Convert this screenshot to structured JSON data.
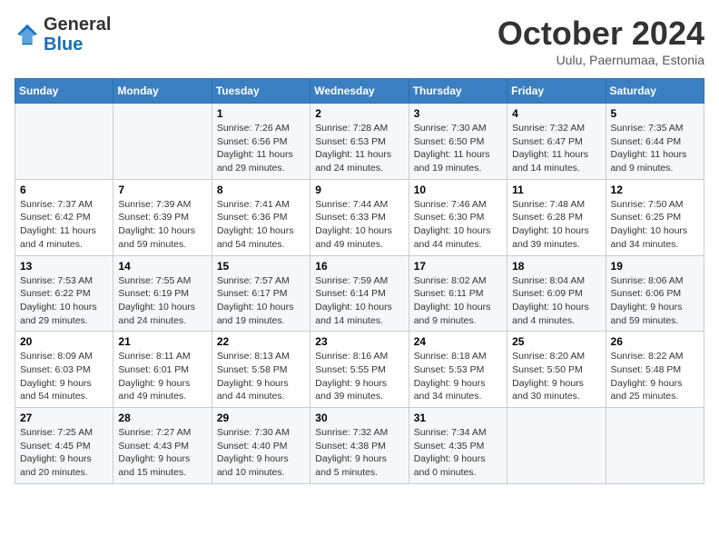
{
  "header": {
    "logo_general": "General",
    "logo_blue": "Blue",
    "month": "October 2024",
    "location": "Uulu, Paernumaa, Estonia"
  },
  "weekdays": [
    "Sunday",
    "Monday",
    "Tuesday",
    "Wednesday",
    "Thursday",
    "Friday",
    "Saturday"
  ],
  "weeks": [
    [
      {
        "day": "",
        "info": ""
      },
      {
        "day": "",
        "info": ""
      },
      {
        "day": "1",
        "info": "Sunrise: 7:26 AM\nSunset: 6:56 PM\nDaylight: 11 hours\nand 29 minutes."
      },
      {
        "day": "2",
        "info": "Sunrise: 7:28 AM\nSunset: 6:53 PM\nDaylight: 11 hours\nand 24 minutes."
      },
      {
        "day": "3",
        "info": "Sunrise: 7:30 AM\nSunset: 6:50 PM\nDaylight: 11 hours\nand 19 minutes."
      },
      {
        "day": "4",
        "info": "Sunrise: 7:32 AM\nSunset: 6:47 PM\nDaylight: 11 hours\nand 14 minutes."
      },
      {
        "day": "5",
        "info": "Sunrise: 7:35 AM\nSunset: 6:44 PM\nDaylight: 11 hours\nand 9 minutes."
      }
    ],
    [
      {
        "day": "6",
        "info": "Sunrise: 7:37 AM\nSunset: 6:42 PM\nDaylight: 11 hours\nand 4 minutes."
      },
      {
        "day": "7",
        "info": "Sunrise: 7:39 AM\nSunset: 6:39 PM\nDaylight: 10 hours\nand 59 minutes."
      },
      {
        "day": "8",
        "info": "Sunrise: 7:41 AM\nSunset: 6:36 PM\nDaylight: 10 hours\nand 54 minutes."
      },
      {
        "day": "9",
        "info": "Sunrise: 7:44 AM\nSunset: 6:33 PM\nDaylight: 10 hours\nand 49 minutes."
      },
      {
        "day": "10",
        "info": "Sunrise: 7:46 AM\nSunset: 6:30 PM\nDaylight: 10 hours\nand 44 minutes."
      },
      {
        "day": "11",
        "info": "Sunrise: 7:48 AM\nSunset: 6:28 PM\nDaylight: 10 hours\nand 39 minutes."
      },
      {
        "day": "12",
        "info": "Sunrise: 7:50 AM\nSunset: 6:25 PM\nDaylight: 10 hours\nand 34 minutes."
      }
    ],
    [
      {
        "day": "13",
        "info": "Sunrise: 7:53 AM\nSunset: 6:22 PM\nDaylight: 10 hours\nand 29 minutes."
      },
      {
        "day": "14",
        "info": "Sunrise: 7:55 AM\nSunset: 6:19 PM\nDaylight: 10 hours\nand 24 minutes."
      },
      {
        "day": "15",
        "info": "Sunrise: 7:57 AM\nSunset: 6:17 PM\nDaylight: 10 hours\nand 19 minutes."
      },
      {
        "day": "16",
        "info": "Sunrise: 7:59 AM\nSunset: 6:14 PM\nDaylight: 10 hours\nand 14 minutes."
      },
      {
        "day": "17",
        "info": "Sunrise: 8:02 AM\nSunset: 6:11 PM\nDaylight: 10 hours\nand 9 minutes."
      },
      {
        "day": "18",
        "info": "Sunrise: 8:04 AM\nSunset: 6:09 PM\nDaylight: 10 hours\nand 4 minutes."
      },
      {
        "day": "19",
        "info": "Sunrise: 8:06 AM\nSunset: 6:06 PM\nDaylight: 9 hours\nand 59 minutes."
      }
    ],
    [
      {
        "day": "20",
        "info": "Sunrise: 8:09 AM\nSunset: 6:03 PM\nDaylight: 9 hours\nand 54 minutes."
      },
      {
        "day": "21",
        "info": "Sunrise: 8:11 AM\nSunset: 6:01 PM\nDaylight: 9 hours\nand 49 minutes."
      },
      {
        "day": "22",
        "info": "Sunrise: 8:13 AM\nSunset: 5:58 PM\nDaylight: 9 hours\nand 44 minutes."
      },
      {
        "day": "23",
        "info": "Sunrise: 8:16 AM\nSunset: 5:55 PM\nDaylight: 9 hours\nand 39 minutes."
      },
      {
        "day": "24",
        "info": "Sunrise: 8:18 AM\nSunset: 5:53 PM\nDaylight: 9 hours\nand 34 minutes."
      },
      {
        "day": "25",
        "info": "Sunrise: 8:20 AM\nSunset: 5:50 PM\nDaylight: 9 hours\nand 30 minutes."
      },
      {
        "day": "26",
        "info": "Sunrise: 8:22 AM\nSunset: 5:48 PM\nDaylight: 9 hours\nand 25 minutes."
      }
    ],
    [
      {
        "day": "27",
        "info": "Sunrise: 7:25 AM\nSunset: 4:45 PM\nDaylight: 9 hours\nand 20 minutes."
      },
      {
        "day": "28",
        "info": "Sunrise: 7:27 AM\nSunset: 4:43 PM\nDaylight: 9 hours\nand 15 minutes."
      },
      {
        "day": "29",
        "info": "Sunrise: 7:30 AM\nSunset: 4:40 PM\nDaylight: 9 hours\nand 10 minutes."
      },
      {
        "day": "30",
        "info": "Sunrise: 7:32 AM\nSunset: 4:38 PM\nDaylight: 9 hours\nand 5 minutes."
      },
      {
        "day": "31",
        "info": "Sunrise: 7:34 AM\nSunset: 4:35 PM\nDaylight: 9 hours\nand 0 minutes."
      },
      {
        "day": "",
        "info": ""
      },
      {
        "day": "",
        "info": ""
      }
    ]
  ]
}
